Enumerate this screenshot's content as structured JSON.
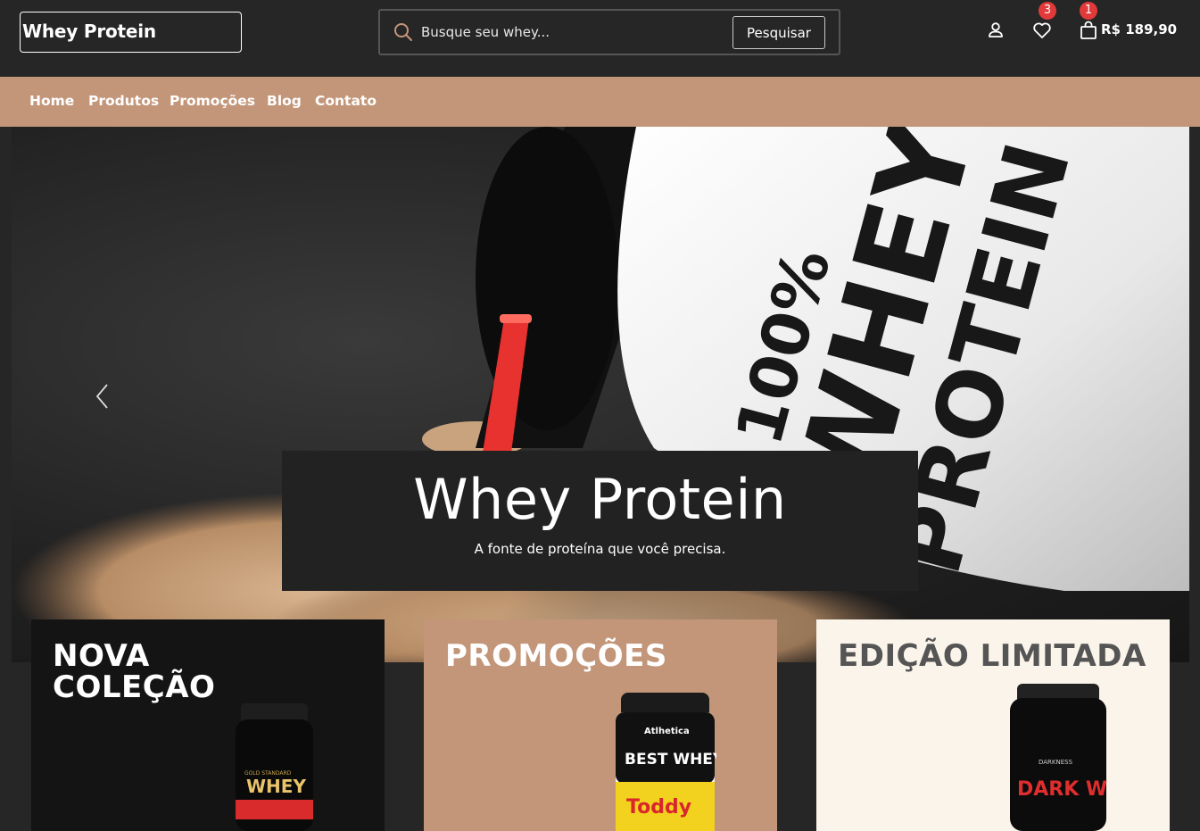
{
  "header": {
    "logo": "Whey Protein",
    "search_placeholder": "Busque seu whey...",
    "search_button": "Pesquisar",
    "wishlist_count": "3",
    "cart_count": "1",
    "cart_total": "R$ 189,90"
  },
  "nav": {
    "items": [
      {
        "label": "Home"
      },
      {
        "label": "Produtos"
      },
      {
        "label": "Promoções"
      },
      {
        "label": "Blog"
      },
      {
        "label": "Contato"
      }
    ]
  },
  "hero": {
    "title": "Whey Protein",
    "subtitle": "A fonte de proteína que você precisa.",
    "jar_label_1": "100%",
    "jar_label_2": "WHEY",
    "jar_label_3": "PROTEIN"
  },
  "cards": [
    {
      "title": "NOVA COLEÇÃO",
      "bg": "#141414",
      "color": "#ffffff",
      "product_label": "WHEY",
      "product_top": "GOLD STANDARD"
    },
    {
      "title": "PROMOÇÕES",
      "bg": "#c3967a",
      "color": "#ffffff",
      "product_label": "BEST WHEY",
      "product_top": "Atlhetica",
      "product_badge": "Toddy"
    },
    {
      "title": "EDIÇÃO LIMITADA",
      "bg": "#fbf4ea",
      "color": "#555555",
      "product_label": "DARK WHEY",
      "product_top": "DARKNESS"
    }
  ],
  "colors": {
    "accent": "#c3967a",
    "dark": "#262626",
    "badge": "#e23a3a"
  }
}
